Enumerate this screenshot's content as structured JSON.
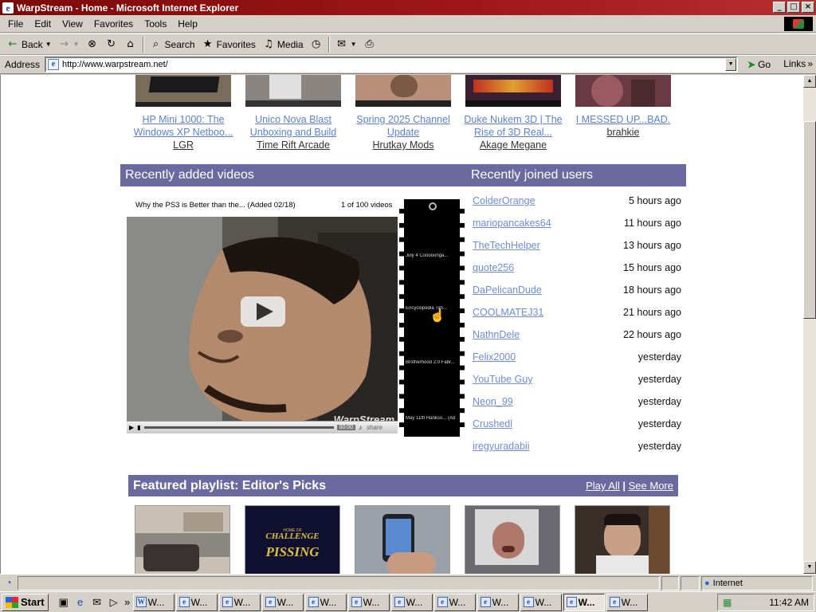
{
  "window": {
    "title": "WarpStream - Home - Microsoft Internet Explorer",
    "controls": [
      "_",
      "□",
      "×"
    ]
  },
  "menu": [
    "File",
    "Edit",
    "View",
    "Favorites",
    "Tools",
    "Help"
  ],
  "toolbar": {
    "back": "Back",
    "search": "Search",
    "favorites": "Favorites",
    "media": "Media"
  },
  "address": {
    "label": "Address",
    "url": "http://www.warpstream.net/",
    "go": "Go",
    "links": "Links"
  },
  "top_videos": [
    {
      "title_line1": "HP Mini 1000: The",
      "title_line2": "Windows XP Netboo...",
      "author": "LGR"
    },
    {
      "title_line1": "Unico Nova Blast",
      "title_line2": "Unboxing and Build",
      "author": "Time Rift Arcade"
    },
    {
      "title_line1": "Spring 2025 Channel",
      "title_line2": "Update",
      "author": "Hrutkay Mods"
    },
    {
      "title_line1": "Duke Nukem 3D | The",
      "title_line2": "Rise of 3D Real...",
      "author": "Akage Megane"
    },
    {
      "title_line1": "I MESSED UP...BAD.",
      "title_line2": "",
      "author": "brahkie"
    }
  ],
  "recent_videos": {
    "header": "Recently added videos",
    "caption": "Why the PS3 is Better than the... (Added 02/18)",
    "count": "1 of 100 videos",
    "watermark": "WarpStream",
    "time": "00:00",
    "share": "share",
    "filmstrip": [
      "July 4 Cooooonga...",
      "Encyclopedia Tim...",
      "Brotherhood 2.0 Fabr...",
      "May 11th Hankso... (Ad"
    ]
  },
  "recent_users": {
    "header": "Recently joined users",
    "rows": [
      {
        "name": "ColderOrange",
        "joined": "5 hours ago"
      },
      {
        "name": "mariopancakes64",
        "joined": "11 hours ago"
      },
      {
        "name": "TheTechHelper",
        "joined": "13 hours ago"
      },
      {
        "name": "quote256",
        "joined": "15 hours ago"
      },
      {
        "name": "DaPelicanDude",
        "joined": "18 hours ago"
      },
      {
        "name": "COOLMATEJ31",
        "joined": "21 hours ago"
      },
      {
        "name": "NathnDele",
        "joined": "22 hours ago"
      },
      {
        "name": "Felix2000",
        "joined": "yesterday"
      },
      {
        "name": "YouTube Guy",
        "joined": "yesterday"
      },
      {
        "name": "Neon_99",
        "joined": "yesterday"
      },
      {
        "name": "Crushedl",
        "joined": "yesterday"
      },
      {
        "name": "iregyuradabii",
        "joined": "yesterday"
      }
    ]
  },
  "playlist": {
    "header": "Featured playlist: Editor's Picks",
    "play_all": "Play All",
    "separator": "|",
    "see_more": "See More",
    "thumb2_line1": "HOME OF",
    "thumb2_line2": "CHALLENGE",
    "thumb2_line3": "PISSING"
  },
  "status": {
    "zone": "Internet"
  },
  "taskbar": {
    "start": "Start",
    "task_label": "W...",
    "clock": "11:42 AM"
  }
}
